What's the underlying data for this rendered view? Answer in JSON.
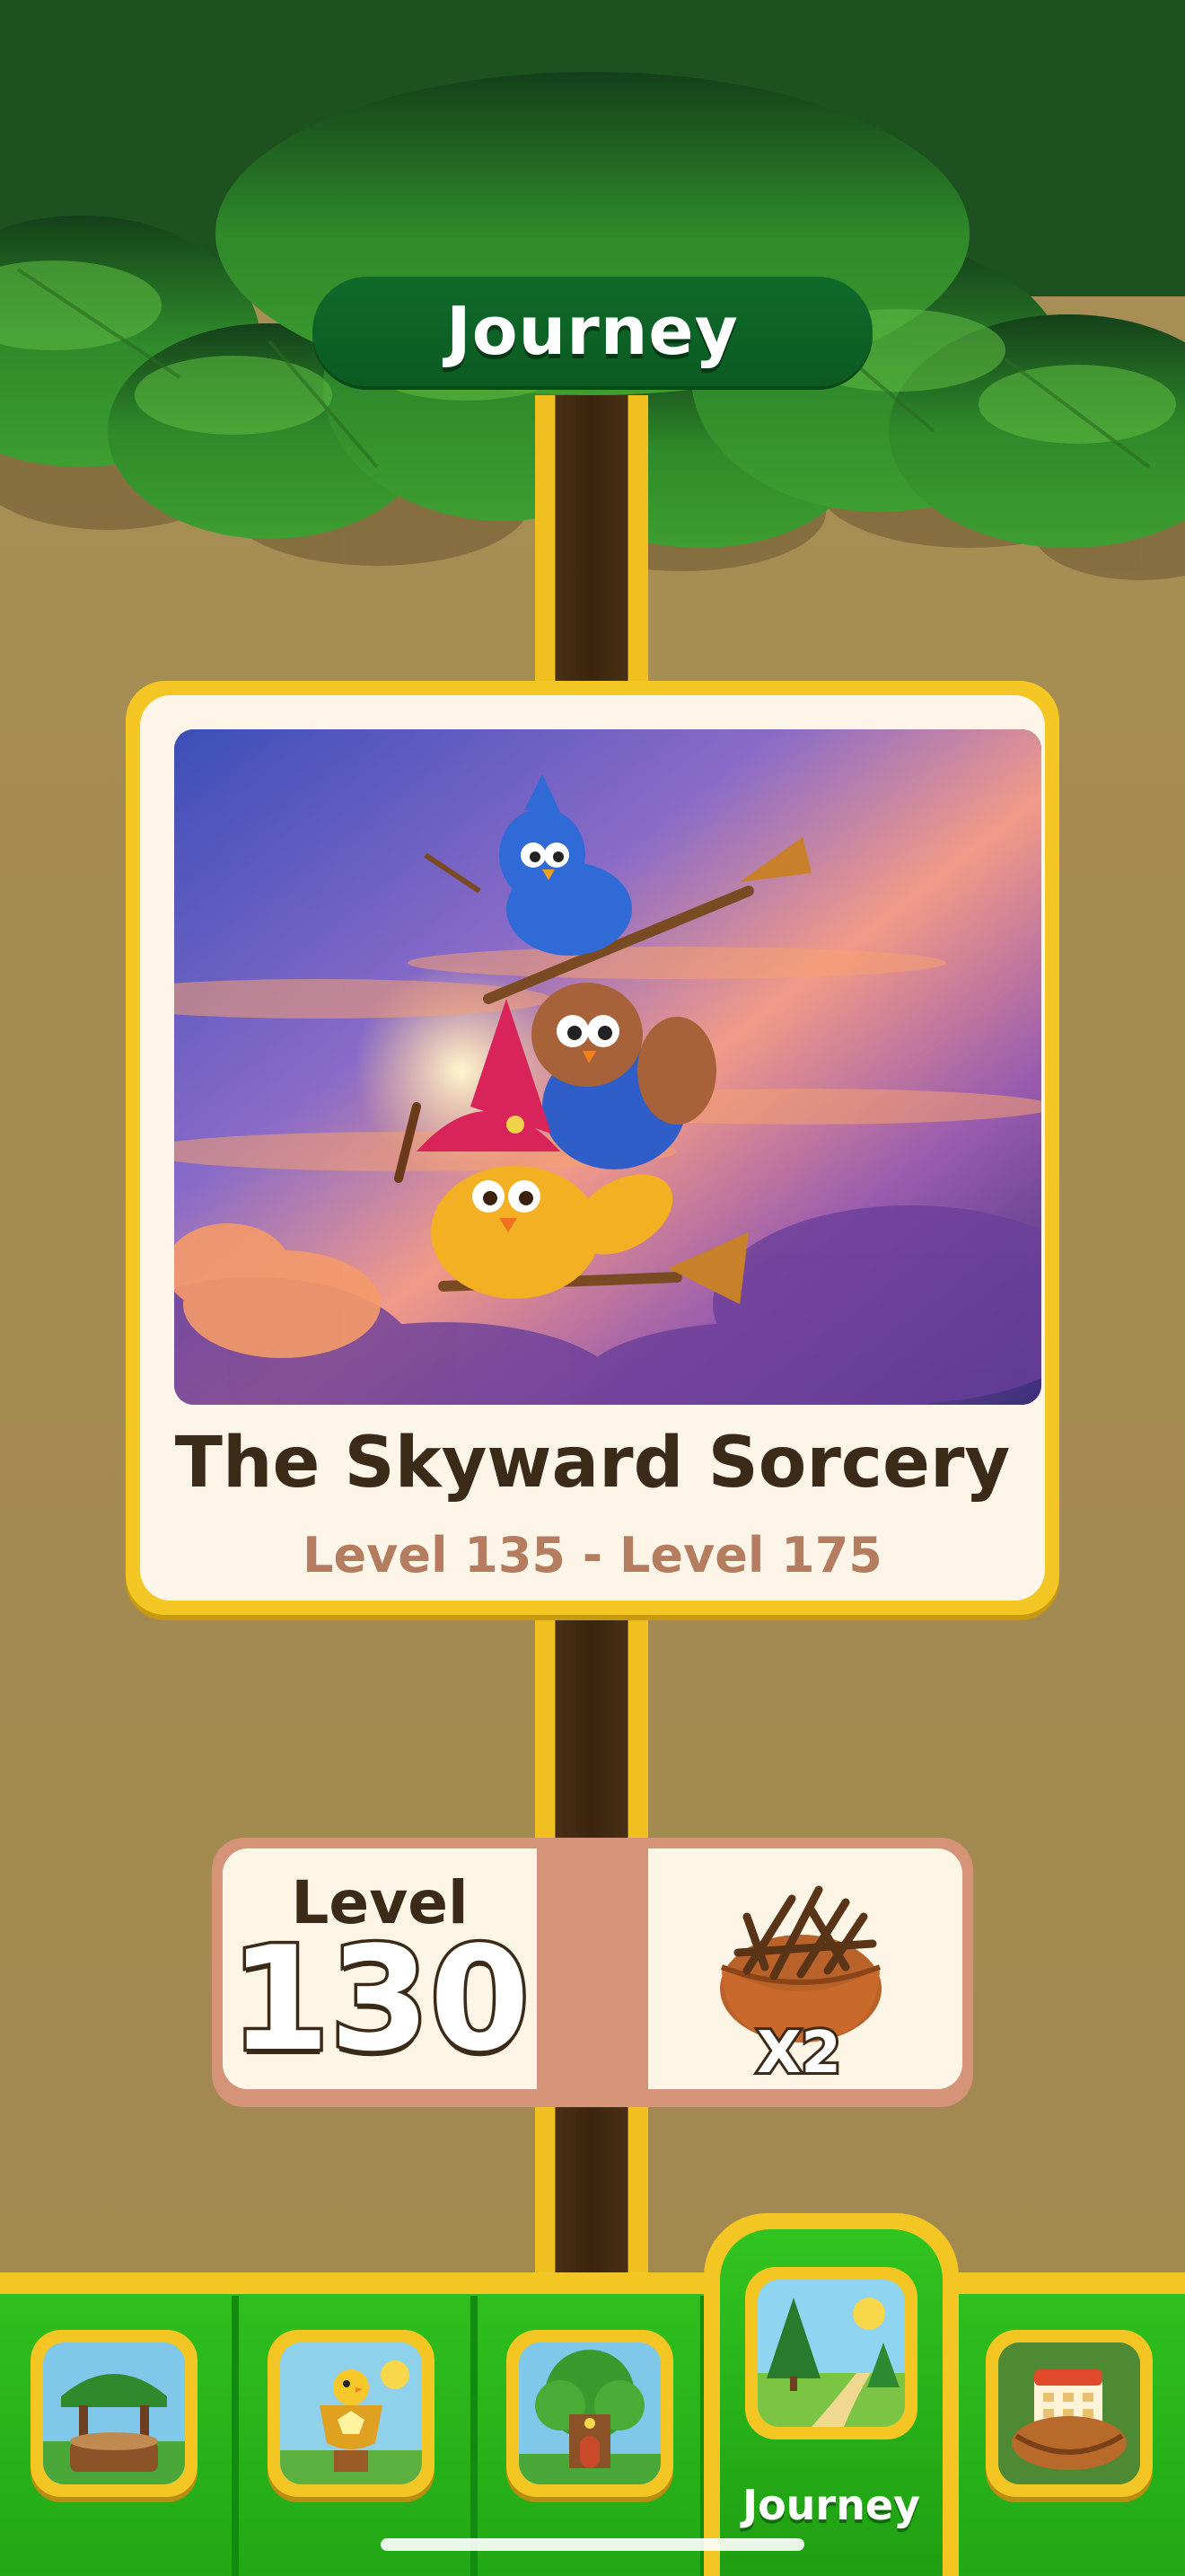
{
  "header": {
    "title": "Journey"
  },
  "chapter": {
    "title": "The Skyward Sorcery",
    "level_range": "Level 135 - Level 175",
    "image": "witch-birds-on-brooms-illustration"
  },
  "current_level": {
    "label": "Level",
    "number": "130",
    "reward_icon": "twig-nest-icon",
    "reward_multiplier": "X2"
  },
  "nav": {
    "tabs": [
      {
        "icon": "tree-stump-shop-icon",
        "active": false
      },
      {
        "icon": "trophy-chick-icon",
        "active": false
      },
      {
        "icon": "tree-house-icon",
        "active": false
      },
      {
        "icon": "journey-path-icon",
        "label": "Journey",
        "active": true
      },
      {
        "icon": "calendar-nest-icon",
        "active": false
      }
    ]
  },
  "colors": {
    "accent_gold": "#f3c623",
    "nav_green": "#2fbf1e",
    "header_green": "#0f6b2a",
    "wall": "#a38a50"
  }
}
